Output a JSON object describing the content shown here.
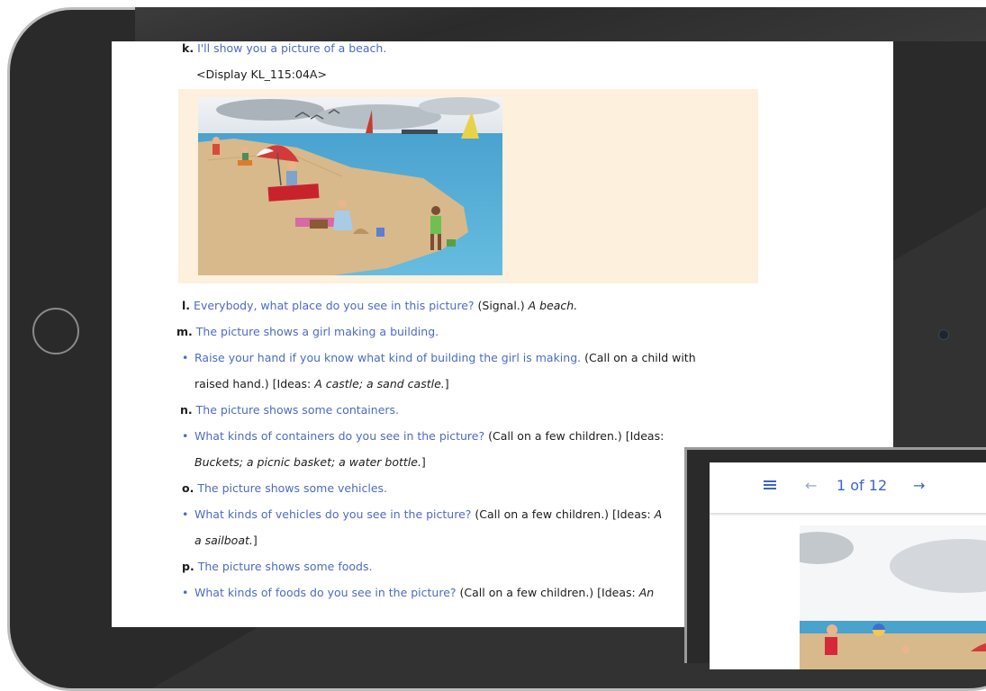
{
  "lesson": {
    "k": {
      "label": "k.",
      "text": "I'll show you a picture of a beach."
    },
    "display_ref": "<Display KL_115:04A>",
    "l": {
      "label": "l.",
      "text": "Everybody, what place do you see in this picture?",
      "signal": "(Signal.)",
      "answer": "A beach."
    },
    "m": {
      "label": "m.",
      "text": "The picture shows a girl making a building."
    },
    "m_bullet": {
      "text": "Raise your hand if you know what kind of building the girl is making.",
      "call": "(Call on a child with",
      "call_cont": "raised hand.) [Ideas:",
      "ideas": "A castle; a sand castle.",
      "close": "]"
    },
    "n": {
      "label": "n.",
      "text": "The picture shows some containers."
    },
    "n_bullet": {
      "text": "What kinds of containers do you see in the picture?",
      "call": "(Call on a few children.) [Ideas:",
      "ideas": "Buckets; a picnic basket; a water bottle.",
      "close": "]"
    },
    "o": {
      "label": "o.",
      "text": "The picture shows some vehicles."
    },
    "o_bullet": {
      "text": "What kinds of vehicles do you see in the picture?",
      "call": "(Call on a few children.) [Ideas:",
      "ideas_cut": "A",
      "ideas": "a sailboat.",
      "close": "]"
    },
    "p": {
      "label": "p.",
      "text": "The picture shows some foods."
    },
    "p_bullet": {
      "text": "What kinds of foods do you see in the picture?",
      "call": "(Call on a few children.) [Ideas:",
      "ideas_cut": "An"
    }
  },
  "viewer": {
    "menu_icon": "menu-icon",
    "prev_icon": "arrow-left-icon",
    "page_indicator": "1 of 12",
    "next_icon": "arrow-right-icon"
  },
  "colors": {
    "instruction_blue": "#4d6bc3",
    "image_panel_bg": "#fdf0dc",
    "bezel": "#2a2a2a",
    "viewer_accent": "#3b63c7"
  }
}
